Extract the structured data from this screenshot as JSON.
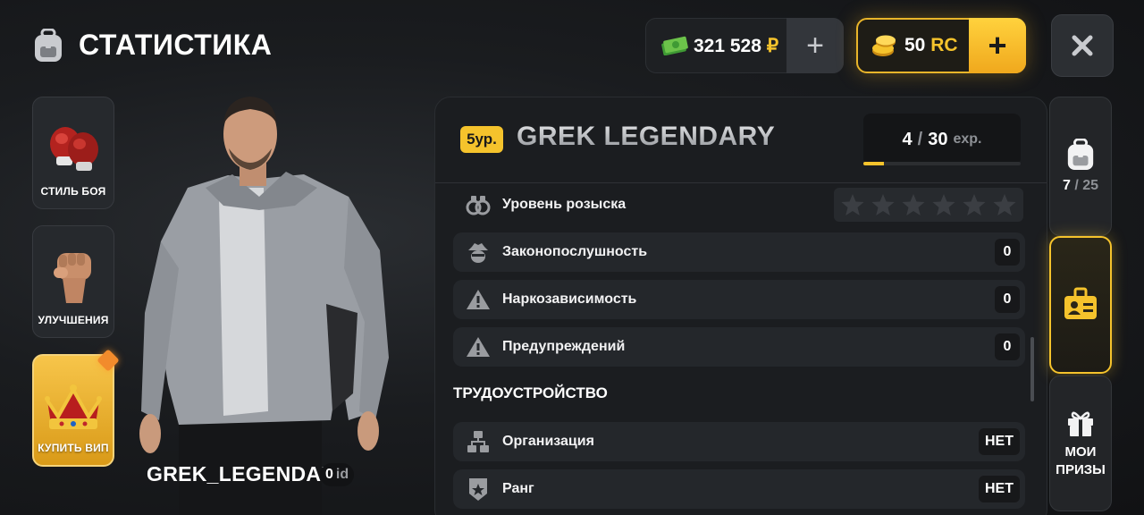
{
  "header": {
    "title": "СТАТИСТИКА"
  },
  "currency": {
    "money_value": "321 528",
    "money_symbol": "₽",
    "rc_value": "50",
    "rc_symbol": "RC",
    "plus_label": "+"
  },
  "left_menu": [
    {
      "label": "СТИЛЬ БОЯ",
      "icon": "boxing-gloves-icon"
    },
    {
      "label": "УЛУЧШЕНИЯ",
      "icon": "fist-icon"
    },
    {
      "label": "КУПИТЬ ВИП",
      "icon": "crown-icon"
    }
  ],
  "character": {
    "name": "GREK_LEGENDARY",
    "id_value": "0",
    "id_label": "id"
  },
  "profile": {
    "level_badge": "5ур.",
    "name": "GREK LEGENDARY",
    "exp_current": "4",
    "exp_sep": "/",
    "exp_max": "30",
    "exp_unit": "exp.",
    "exp_fraction": 0.133
  },
  "stats": [
    {
      "label": "Уровень розыска",
      "icon": "handcuffs-icon",
      "stars_filled": 0,
      "stars_total": 6
    },
    {
      "label": "Законопослушность",
      "icon": "detective-icon",
      "value": "0"
    },
    {
      "label": "Наркозависимость",
      "icon": "warning-icon",
      "value": "0"
    },
    {
      "label": "Предупреждений",
      "icon": "warning-icon",
      "value": "0"
    }
  ],
  "employment": {
    "title": "ТРУДОУСТРОЙСТВО",
    "rows": [
      {
        "label": "Организация",
        "icon": "organization-icon",
        "value": "НЕТ"
      },
      {
        "label": "Ранг",
        "icon": "rank-icon",
        "value": "НЕТ"
      }
    ]
  },
  "right_tabs": {
    "inventory_current": "7",
    "inventory_sep": "/",
    "inventory_max": "25",
    "prizes_line1": "МОИ",
    "prizes_line2": "ПРИЗЫ"
  },
  "colors": {
    "accent": "#f5c32c",
    "panel": "#1b1d20",
    "row": "#24272b"
  }
}
